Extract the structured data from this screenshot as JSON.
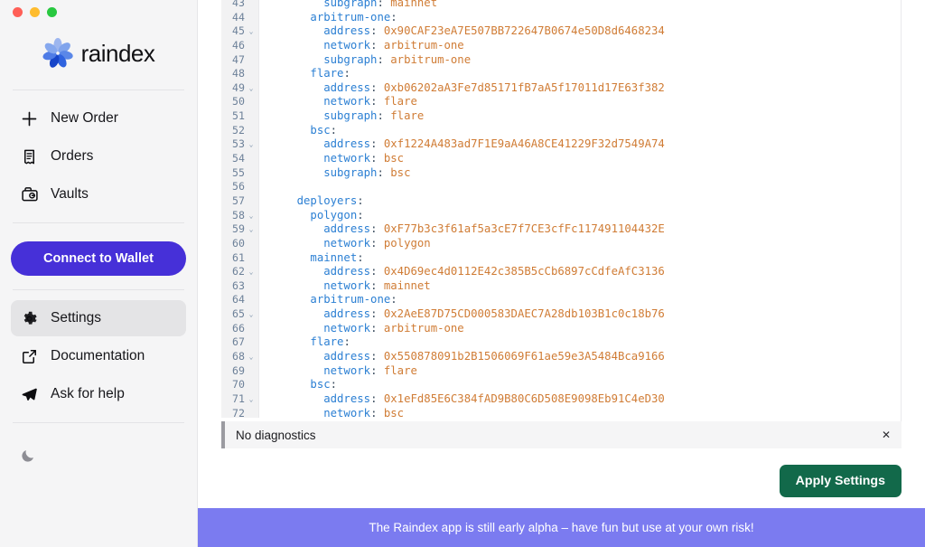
{
  "window": {
    "traffic_lights": [
      "close",
      "minimize",
      "zoom"
    ],
    "colors": {
      "close": "#ff5f57",
      "minimize": "#febc2e",
      "zoom": "#28c840",
      "accent_purple": "#4630d8",
      "accent_green": "#12694a",
      "banner_purple": "#7b7bf0",
      "yaml_key": "#2b7fd3",
      "yaml_value": "#d07c35"
    }
  },
  "sidebar": {
    "brand": "raindex",
    "nav_primary": [
      {
        "label": "New Order",
        "icon": "plus-icon"
      },
      {
        "label": "Orders",
        "icon": "receipt-icon"
      },
      {
        "label": "Vaults",
        "icon": "vault-icon"
      }
    ],
    "wallet_button": "Connect to Wallet",
    "nav_secondary": [
      {
        "label": "Settings",
        "icon": "gear-icon",
        "active": true
      },
      {
        "label": "Documentation",
        "icon": "external-link-icon",
        "active": false
      },
      {
        "label": "Ask for help",
        "icon": "paper-plane-icon",
        "active": false
      }
    ],
    "theme_toggle_icon": "moon-icon"
  },
  "editor": {
    "language": "yaml",
    "first_visible_line": 43,
    "lines": [
      {
        "n": 43,
        "fold": false,
        "indent": 4,
        "key": "subgraph",
        "value": "mainnet"
      },
      {
        "n": 44,
        "fold": false,
        "indent": 3,
        "key": "arbitrum-one",
        "value": ""
      },
      {
        "n": 45,
        "fold": true,
        "indent": 4,
        "key": "address",
        "value": "0x90CAF23eA7E507BB722647B0674e50D8d6468234"
      },
      {
        "n": 46,
        "fold": false,
        "indent": 4,
        "key": "network",
        "value": "arbitrum-one"
      },
      {
        "n": 47,
        "fold": false,
        "indent": 4,
        "key": "subgraph",
        "value": "arbitrum-one"
      },
      {
        "n": 48,
        "fold": false,
        "indent": 3,
        "key": "flare",
        "value": ""
      },
      {
        "n": 49,
        "fold": true,
        "indent": 4,
        "key": "address",
        "value": "0xb06202aA3Fe7d85171fB7aA5f17011d17E63f382"
      },
      {
        "n": 50,
        "fold": false,
        "indent": 4,
        "key": "network",
        "value": "flare"
      },
      {
        "n": 51,
        "fold": false,
        "indent": 4,
        "key": "subgraph",
        "value": "flare"
      },
      {
        "n": 52,
        "fold": false,
        "indent": 3,
        "key": "bsc",
        "value": ""
      },
      {
        "n": 53,
        "fold": true,
        "indent": 4,
        "key": "address",
        "value": "0xf1224A483ad7F1E9aA46A8CE41229F32d7549A74"
      },
      {
        "n": 54,
        "fold": false,
        "indent": 4,
        "key": "network",
        "value": "bsc"
      },
      {
        "n": 55,
        "fold": false,
        "indent": 4,
        "key": "subgraph",
        "value": "bsc"
      },
      {
        "n": 56,
        "fold": false,
        "indent": 0,
        "key": "",
        "value": ""
      },
      {
        "n": 57,
        "fold": false,
        "indent": 2,
        "key": "deployers",
        "value": ""
      },
      {
        "n": 58,
        "fold": true,
        "indent": 3,
        "key": "polygon",
        "value": ""
      },
      {
        "n": 59,
        "fold": true,
        "indent": 4,
        "key": "address",
        "value": "0xF77b3c3f61af5a3cE7f7CE3cfFc117491104432E"
      },
      {
        "n": 60,
        "fold": false,
        "indent": 4,
        "key": "network",
        "value": "polygon"
      },
      {
        "n": 61,
        "fold": false,
        "indent": 3,
        "key": "mainnet",
        "value": ""
      },
      {
        "n": 62,
        "fold": true,
        "indent": 4,
        "key": "address",
        "value": "0x4D69ec4d0112E42c385B5cCb6897cCdfeAfC3136"
      },
      {
        "n": 63,
        "fold": false,
        "indent": 4,
        "key": "network",
        "value": "mainnet"
      },
      {
        "n": 64,
        "fold": false,
        "indent": 3,
        "key": "arbitrum-one",
        "value": ""
      },
      {
        "n": 65,
        "fold": true,
        "indent": 4,
        "key": "address",
        "value": "0x2AeE87D75CD000583DAEC7A28db103B1c0c18b76"
      },
      {
        "n": 66,
        "fold": false,
        "indent": 4,
        "key": "network",
        "value": "arbitrum-one"
      },
      {
        "n": 67,
        "fold": false,
        "indent": 3,
        "key": "flare",
        "value": ""
      },
      {
        "n": 68,
        "fold": true,
        "indent": 4,
        "key": "address",
        "value": "0x550878091b2B1506069F61ae59e3A5484Bca9166"
      },
      {
        "n": 69,
        "fold": false,
        "indent": 4,
        "key": "network",
        "value": "flare"
      },
      {
        "n": 70,
        "fold": false,
        "indent": 3,
        "key": "bsc",
        "value": ""
      },
      {
        "n": 71,
        "fold": true,
        "indent": 4,
        "key": "address",
        "value": "0x1eFd85E6C384fAD9B80C6D508E9098Eb91C4eD30"
      },
      {
        "n": 72,
        "fold": false,
        "indent": 4,
        "key": "network",
        "value": "bsc"
      }
    ]
  },
  "diagnostics": {
    "message": "No diagnostics",
    "close_label": "✕"
  },
  "actions": {
    "apply_label": "Apply Settings"
  },
  "banner": {
    "message": "The Raindex app is still early alpha – have fun but use at your own risk!"
  }
}
